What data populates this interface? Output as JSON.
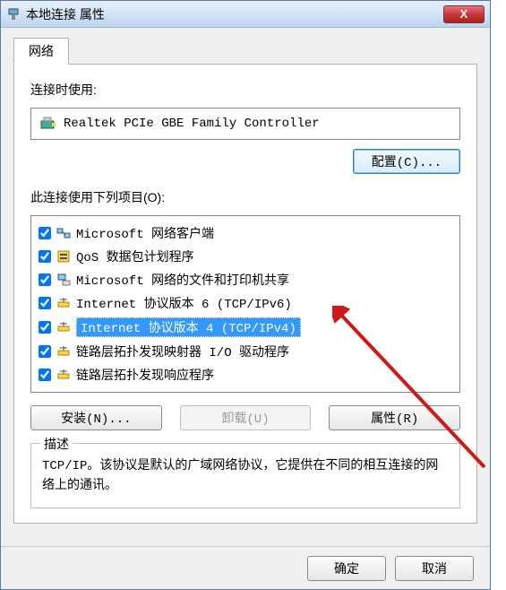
{
  "window": {
    "title": "本地连接 属性",
    "close": "X"
  },
  "tab": {
    "network": "网络"
  },
  "connect_using_label": "连接时使用:",
  "adapter": {
    "name": "Realtek PCIe GBE Family Controller"
  },
  "configure_btn": "配置(C)...",
  "items_label": "此连接使用下列项目(O):",
  "items": [
    {
      "label": "Microsoft 网络客户端",
      "checked": true,
      "selected": false
    },
    {
      "label": "QoS 数据包计划程序",
      "checked": true,
      "selected": false
    },
    {
      "label": "Microsoft 网络的文件和打印机共享",
      "checked": true,
      "selected": false
    },
    {
      "label": "Internet 协议版本 6 (TCP/IPv6)",
      "checked": true,
      "selected": false
    },
    {
      "label": "Internet 协议版本 4 (TCP/IPv4)",
      "checked": true,
      "selected": true
    },
    {
      "label": "链路层拓扑发现映射器 I/O 驱动程序",
      "checked": true,
      "selected": false
    },
    {
      "label": "链路层拓扑发现响应程序",
      "checked": true,
      "selected": false
    }
  ],
  "buttons": {
    "install": "安装(N)...",
    "uninstall": "卸载(U)",
    "properties": "属性(R)",
    "ok": "确定",
    "cancel": "取消"
  },
  "description": {
    "legend": "描述",
    "text": "TCP/IP。该协议是默认的广域网络协议，它提供在不同的相互连接的网络上的通讯。"
  },
  "annotation": {
    "arrow_color": "#d01818"
  }
}
